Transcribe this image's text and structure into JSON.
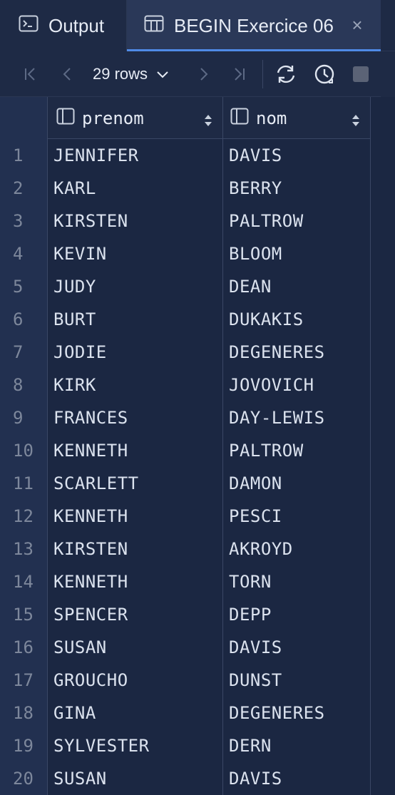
{
  "tabs": {
    "output_label": "Output",
    "active_label": "BEGIN Exercice 06"
  },
  "toolbar": {
    "rows_label": "29 rows"
  },
  "grid": {
    "columns": [
      "prenom",
      "nom"
    ],
    "rows": [
      {
        "n": "1",
        "prenom": "JENNIFER",
        "nom": "DAVIS"
      },
      {
        "n": "2",
        "prenom": "KARL",
        "nom": "BERRY"
      },
      {
        "n": "3",
        "prenom": "KIRSTEN",
        "nom": "PALTROW"
      },
      {
        "n": "4",
        "prenom": "KEVIN",
        "nom": "BLOOM"
      },
      {
        "n": "5",
        "prenom": "JUDY",
        "nom": "DEAN"
      },
      {
        "n": "6",
        "prenom": "BURT",
        "nom": "DUKAKIS"
      },
      {
        "n": "7",
        "prenom": "JODIE",
        "nom": "DEGENERES"
      },
      {
        "n": "8",
        "prenom": "KIRK",
        "nom": "JOVOVICH"
      },
      {
        "n": "9",
        "prenom": "FRANCES",
        "nom": "DAY-LEWIS"
      },
      {
        "n": "10",
        "prenom": "KENNETH",
        "nom": "PALTROW"
      },
      {
        "n": "11",
        "prenom": "SCARLETT",
        "nom": "DAMON"
      },
      {
        "n": "12",
        "prenom": "KENNETH",
        "nom": "PESCI"
      },
      {
        "n": "13",
        "prenom": "KIRSTEN",
        "nom": "AKROYD"
      },
      {
        "n": "14",
        "prenom": "KENNETH",
        "nom": "TORN"
      },
      {
        "n": "15",
        "prenom": "SPENCER",
        "nom": "DEPP"
      },
      {
        "n": "16",
        "prenom": "SUSAN",
        "nom": "DAVIS"
      },
      {
        "n": "17",
        "prenom": "GROUCHO",
        "nom": "DUNST"
      },
      {
        "n": "18",
        "prenom": "GINA",
        "nom": "DEGENERES"
      },
      {
        "n": "19",
        "prenom": "SYLVESTER",
        "nom": "DERN"
      },
      {
        "n": "20",
        "prenom": "SUSAN",
        "nom": "DAVIS"
      }
    ]
  },
  "colors": {
    "background": "#1b2742",
    "accent": "#4f8ae6"
  }
}
